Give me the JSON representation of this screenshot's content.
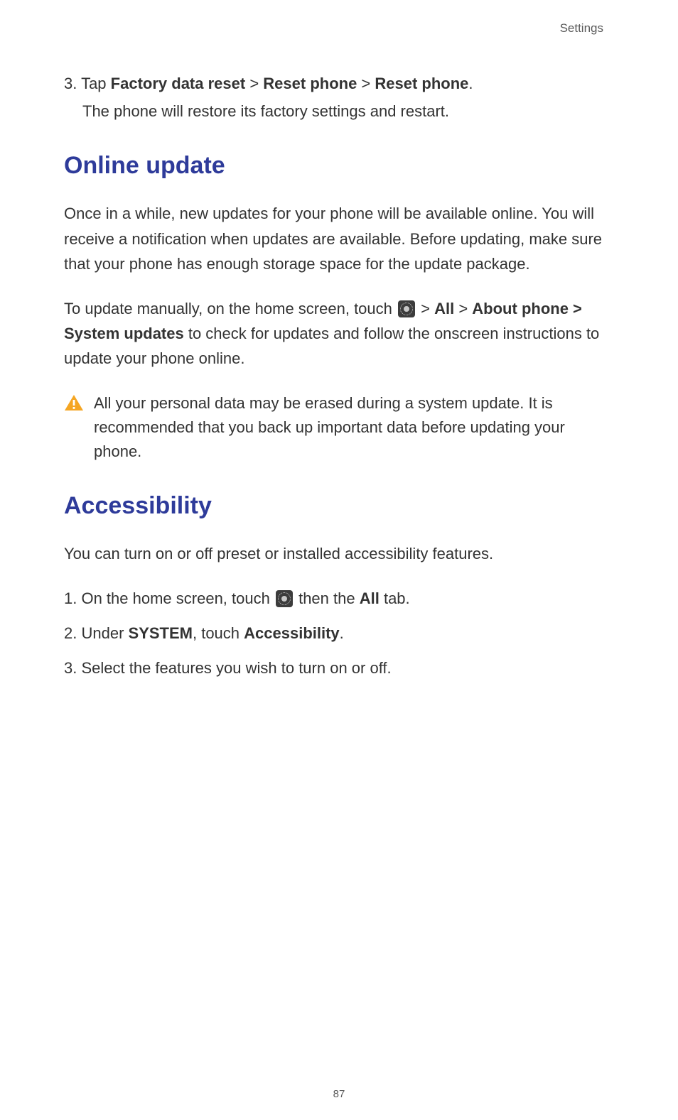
{
  "header": {
    "label": "Settings"
  },
  "reset": {
    "num": "3.",
    "pre": " Tap ",
    "b1": "Factory data reset",
    "sep1": " > ",
    "b2": "Reset phone",
    "sep2": " > ",
    "b3": "Reset phone",
    "post": ".",
    "sub": "The phone will restore its factory settings and restart."
  },
  "online_update": {
    "heading": "Online update",
    "p1": "Once in a while, new updates for your phone will be available online. You will receive a notification when updates are available. Before updating, make sure that your phone has enough storage space for the update package.",
    "p2_pre": "To update manually, on the home screen, touch ",
    "p2_gt1": " > ",
    "p2_b1": "All",
    "p2_gt2": " > ",
    "p2_b2": "About phone > System updates",
    "p2_post": " to check for updates and follow the onscreen instructions to update your phone online.",
    "warning": "All your personal data may be erased during a system update. It is recommended that you back up important data before updating your phone."
  },
  "accessibility": {
    "heading": "Accessibility",
    "p1": "You can turn on or off preset or installed accessibility features.",
    "s1_num": "1.",
    "s1_pre": " On the home screen, touch ",
    "s1_mid": " then the ",
    "s1_b": "All",
    "s1_post": " tab.",
    "s2_num": "2.",
    "s2_pre": " Under ",
    "s2_b1": "SYSTEM",
    "s2_mid": ", touch ",
    "s2_b2": "Accessibility",
    "s2_post": ".",
    "s3_num": "3.",
    "s3_text": " Select the features you wish to turn on or off."
  },
  "page_number": "87"
}
